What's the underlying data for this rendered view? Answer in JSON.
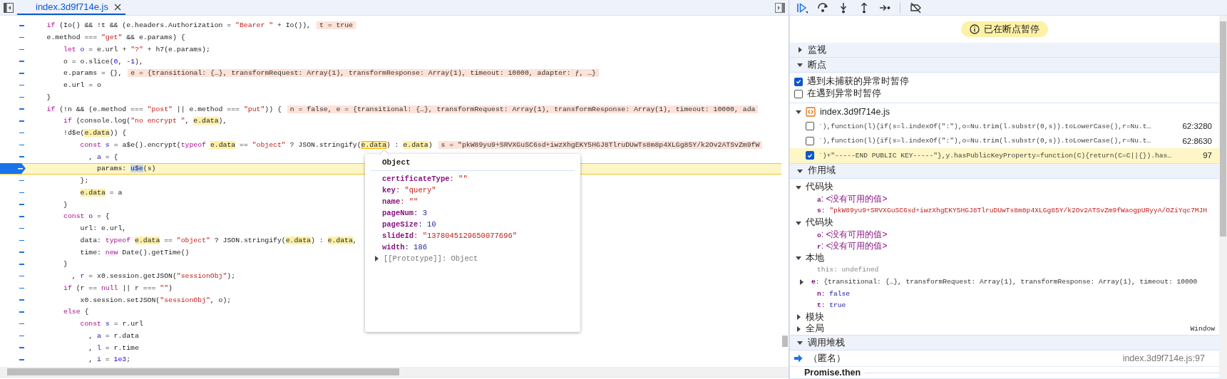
{
  "editor": {
    "tabs": [
      {
        "label": "index.3d9f714e.js",
        "selected": true
      }
    ],
    "lines": [
      {
        "current": false,
        "inline_value": "t = true",
        "tokens": [
          {
            "kind": "kw",
            "text": "    if"
          },
          " (Io() && !t && (e.headers.Authorization = ",
          {
            "kind": "str",
            "text": "\"Bearer \""
          },
          " + Io()),"
        ]
      },
      {
        "current": false,
        "tokens": [
          "    e.method === ",
          {
            "kind": "str",
            "text": "\"get\""
          },
          " && e.params) {"
        ]
      },
      {
        "current": false,
        "tokens": [
          {
            "kind": "kw",
            "text": "        let "
          },
          {
            "kind": "def",
            "text": "o"
          },
          " = e.url + ",
          {
            "kind": "str",
            "text": "\"?\""
          },
          " + h7(e.params);"
        ]
      },
      {
        "current": false,
        "tokens": [
          "        o = o.slice(",
          {
            "kind": "num",
            "text": "0"
          },
          ", ",
          {
            "kind": "num",
            "text": "-1"
          },
          "),"
        ]
      },
      {
        "current": false,
        "inline_value": "e = {transitional: {…}, transformRequest: Array(1), transformResponse: Array(1), timeout: 10000, adapter: ƒ, …}",
        "tokens": [
          "        e.params = {},"
        ]
      },
      {
        "current": false,
        "tokens": [
          "        e.url = o"
        ]
      },
      {
        "current": false,
        "tokens": [
          "    }"
        ]
      },
      {
        "current": false,
        "inline_value": "n = false, e = {transitional: {…}, transformRequest: Array(1), transformResponse: Array(1), timeout: 10000, ada",
        "tokens": [
          {
            "kind": "kw",
            "text": "    if"
          },
          " (!n && (e.method === ",
          {
            "kind": "str",
            "text": "\"post\""
          },
          " || e.method === ",
          {
            "kind": "str",
            "text": "\"put\""
          },
          ")) {"
        ]
      },
      {
        "current": false,
        "tokens": [
          {
            "kind": "kw",
            "text": "        if"
          },
          " (console.log(",
          {
            "kind": "str",
            "text": "\"no encrypt \""
          },
          ", ",
          {
            "kind": "hl",
            "text": "e.data"
          },
          "),"
        ]
      },
      {
        "current": false,
        "tokens": [
          "        !d$e(",
          {
            "kind": "hl",
            "text": "e.data"
          },
          ")) {"
        ]
      },
      {
        "current": false,
        "inline_value": "s = \"pkW89yu9+SRVXGuSC6sd+iwzXhgEKY5HGJ8TlruDUwTs8m8p4XLGg85Y/k2Ov2ATSvZm9fW",
        "tokens": [
          {
            "kind": "kw",
            "text": "            const "
          },
          {
            "kind": "def",
            "text": "s"
          },
          " = a$e().encrypt(",
          {
            "kind": "kw",
            "text": "typeof "
          },
          {
            "kind": "hl",
            "text": "e.data"
          },
          " == ",
          {
            "kind": "str",
            "text": "\"object\""
          },
          " ? JSON.stringify(",
          {
            "kind": "hover",
            "text": "e.data"
          },
          ") : ",
          {
            "kind": "hl",
            "text": "e.data"
          },
          ")"
        ]
      },
      {
        "current": false,
        "tokens": [
          "              , ",
          {
            "kind": "def",
            "text": "a"
          },
          " = {"
        ]
      },
      {
        "current": true,
        "tokens": [
          "                params: ",
          {
            "kind": "sel",
            "text": "u$e"
          },
          "(s)"
        ]
      },
      {
        "current": false,
        "tokens": [
          "            };"
        ]
      },
      {
        "current": false,
        "tokens": [
          {
            "kind": "hl",
            "text": "            e.data"
          },
          " = a"
        ]
      },
      {
        "current": false,
        "tokens": [
          "        }"
        ]
      },
      {
        "current": false,
        "tokens": [
          {
            "kind": "kw",
            "text": "        const "
          },
          {
            "kind": "def",
            "text": "o"
          },
          " = {"
        ]
      },
      {
        "current": false,
        "tokens": [
          "            url: e.url,"
        ]
      },
      {
        "current": false,
        "tokens": [
          "            data: ",
          {
            "kind": "kw",
            "text": "typeof "
          },
          {
            "kind": "hl",
            "text": "e.data"
          },
          " == ",
          {
            "kind": "str",
            "text": "\"object\""
          },
          " ? JSON.stringify(",
          {
            "kind": "hl",
            "text": "e.data"
          },
          ") : ",
          {
            "kind": "hl",
            "text": "e.data"
          },
          ","
        ]
      },
      {
        "current": false,
        "tokens": [
          "            time: ",
          {
            "kind": "kw",
            "text": "new"
          },
          " Date().getTime()"
        ]
      },
      {
        "current": false,
        "tokens": [
          "        }"
        ]
      },
      {
        "current": false,
        "tokens": [
          "          , ",
          {
            "kind": "def",
            "text": "r"
          },
          " = x0.session.getJSON(",
          {
            "kind": "str",
            "text": "\"sessionObj\""
          },
          ");"
        ]
      },
      {
        "current": false,
        "tokens": [
          {
            "kind": "kw",
            "text": "        if"
          },
          " (r == ",
          {
            "kind": "kw",
            "text": "null"
          },
          " || r === ",
          {
            "kind": "str",
            "text": "\"\""
          },
          ")"
        ]
      },
      {
        "current": false,
        "tokens": [
          "            x0.session.setJSON(",
          {
            "kind": "str",
            "text": "\"sessionObj\""
          },
          ", o);"
        ]
      },
      {
        "current": false,
        "tokens": [
          {
            "kind": "kw",
            "text": "        else"
          },
          " {"
        ]
      },
      {
        "current": false,
        "tokens": [
          {
            "kind": "kw",
            "text": "            const "
          },
          {
            "kind": "def",
            "text": "s"
          },
          " = r.url"
        ]
      },
      {
        "current": false,
        "tokens": [
          "              , ",
          {
            "kind": "def",
            "text": "a"
          },
          " = r.data"
        ]
      },
      {
        "current": false,
        "tokens": [
          "              , ",
          {
            "kind": "def",
            "text": "l"
          },
          " = r.time"
        ]
      },
      {
        "current": false,
        "tokens": [
          "              , ",
          {
            "kind": "def",
            "text": "i"
          },
          " = ",
          {
            "kind": "num",
            "text": "1e3"
          },
          ";"
        ]
      }
    ],
    "hover_popup": {
      "title": "Object",
      "properties": [
        {
          "text": "**certificateType**: \"\"",
          "kind": "string"
        },
        {
          "text": "**key**: \"query\"",
          "kind": "string"
        },
        {
          "text": "**name**: \"\"",
          "kind": "string"
        },
        {
          "text": "**pageNum**: 3",
          "kind": "number"
        },
        {
          "text": "**pageSize**: 10",
          "kind": "number"
        },
        {
          "text": "**slideId**: \"1378045129650077696\"",
          "kind": "string"
        },
        {
          "text": "**width**: 186",
          "kind": "number"
        }
      ],
      "prototype": {
        "text": "[[Prototype]]: Object",
        "expanded": false
      }
    }
  },
  "debugger": {
    "status": "已在断点暂停",
    "sections": [
      {
        "kind": "watch",
        "title": "监视",
        "expanded": false
      },
      {
        "kind": "breakpoints",
        "title": "断点",
        "expanded": true,
        "options": [
          {
            "label": "遇到未捕获的异常时暂停",
            "checked": true
          },
          {
            "label": "在遇到异常时暂停",
            "checked": false
          }
        ],
        "files": [
          {
            "name": "index.3d9f714e.js",
            "expanded": true,
            "breakpoints": [
              {
                "code": "`),function(l){if(s=l.indexOf(\":\"),o=Nu.trim(l.substr(0,s)).toLowerCase(),r=Nu.t…",
                "location": "62:3280",
                "checked": false,
                "current": false
              },
              {
                "code": "`),function(l){if(s=l.indexOf(\":\"),o=Nu.trim(l.substr(0,s)).toLowerCase(),r=Nu.t…",
                "location": "62:8630",
                "checked": false,
                "current": false
              },
              {
                "code": "`)+\"-----END PUBLIC KEY-----\"},y.hasPublicKeyProperty=function(C){return(C=C||{}).has…",
                "location": "97",
                "checked": true,
                "current": true
              }
            ]
          }
        ]
      },
      {
        "kind": "scope",
        "title": "作用域",
        "expanded": true,
        "scopes": [
          {
            "title": "代码块",
            "expanded": true,
            "variables": [
              {
                "text": "**a**: <没有可用的值>",
                "kind": "unavailable"
              },
              {
                "text": "**s**: \"pkW89yu9+SRVXGuSC6sd+iwzXhgEKY5HGJ8TlruDUwTs8m8p4XLGg85Y/k2Ov2ATSvZm9fWaogpURyyA/OZiYqc7MJH",
                "kind": "string"
              }
            ]
          },
          {
            "title": "代码块",
            "expanded": true,
            "variables": [
              {
                "text": "**o**: <没有可用的值>",
                "kind": "unavailable"
              },
              {
                "text": "**r**: <没有可用的值>",
                "kind": "unavailable"
              }
            ]
          },
          {
            "title": "本地",
            "expanded": true,
            "variables": [
              {
                "text": "this: undefined",
                "kind": "undefined"
              },
              {
                "text": "**e**: {transitional: {…}, transformRequest: Array(1), transformResponse: Array(1), timeout: 10000",
                "kind": "object",
                "expanded": false
              },
              {
                "text": "**n**: false",
                "kind": "boolean"
              },
              {
                "text": "**t**: true",
                "kind": "boolean"
              }
            ]
          },
          {
            "title": "模块",
            "expanded": false
          },
          {
            "title": "全局",
            "expanded": false,
            "value": "Window"
          }
        ]
      },
      {
        "kind": "callstack",
        "title": "调用堆栈",
        "expanded": true,
        "frames": [
          {
            "name": "（匿名）",
            "location": "index.3d9f714e.js:97",
            "current": true
          }
        ],
        "async_label": "Promise.then"
      }
    ]
  }
}
